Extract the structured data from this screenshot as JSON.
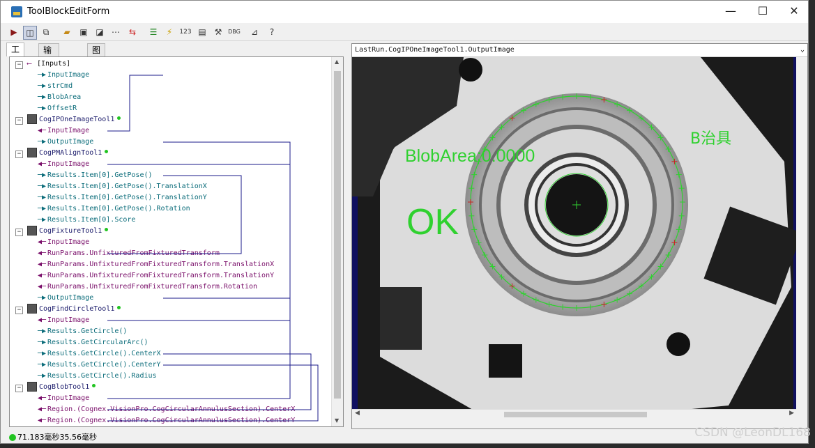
{
  "window": {
    "title": "ToolBlockEditForm"
  },
  "tabs": [
    {
      "label": "工具"
    },
    {
      "label": "输入/输出"
    },
    {
      "label": "图形"
    }
  ],
  "tree": [
    {
      "type": "head",
      "label": "[Inputs]"
    },
    {
      "type": "out",
      "label": "InputImage"
    },
    {
      "type": "out",
      "label": "strCmd"
    },
    {
      "type": "out",
      "label": "BlobArea"
    },
    {
      "type": "out",
      "label": "OffsetR"
    },
    {
      "type": "tool",
      "label": "CogIPOneImageTool1"
    },
    {
      "type": "in",
      "label": "InputImage"
    },
    {
      "type": "out",
      "label": "OutputImage"
    },
    {
      "type": "tool",
      "label": "CogPMAlignTool1"
    },
    {
      "type": "in",
      "label": "InputImage"
    },
    {
      "type": "out",
      "label": "Results.Item[0].GetPose()"
    },
    {
      "type": "out",
      "label": "Results.Item[0].GetPose().TranslationX"
    },
    {
      "type": "out",
      "label": "Results.Item[0].GetPose().TranslationY"
    },
    {
      "type": "out",
      "label": "Results.Item[0].GetPose().Rotation"
    },
    {
      "type": "out",
      "label": "Results.Item[0].Score"
    },
    {
      "type": "tool",
      "label": "CogFixtureTool1"
    },
    {
      "type": "in",
      "label": "InputImage"
    },
    {
      "type": "in",
      "label": "RunParams.UnfixturedFromFixturedTransform"
    },
    {
      "type": "in",
      "label": "RunParams.UnfixturedFromFixturedTransform.TranslationX"
    },
    {
      "type": "in",
      "label": "RunParams.UnfixturedFromFixturedTransform.TranslationY"
    },
    {
      "type": "in",
      "label": "RunParams.UnfixturedFromFixturedTransform.Rotation"
    },
    {
      "type": "out",
      "label": "OutputImage"
    },
    {
      "type": "tool",
      "label": "CogFindCircleTool1"
    },
    {
      "type": "in",
      "label": "InputImage"
    },
    {
      "type": "out",
      "label": "Results.GetCircle()"
    },
    {
      "type": "out",
      "label": "Results.GetCircularArc()"
    },
    {
      "type": "out",
      "label": "Results.GetCircle().CenterX"
    },
    {
      "type": "out",
      "label": "Results.GetCircle().CenterY"
    },
    {
      "type": "out",
      "label": "Results.GetCircle().Radius"
    },
    {
      "type": "tool",
      "label": "CogBlobTool1"
    },
    {
      "type": "in",
      "label": "InputImage"
    },
    {
      "type": "in",
      "label": "Region.(Cognex.VisionPro.CogCircularAnnulusSection).CenterX"
    },
    {
      "type": "in",
      "label": "Region.(Cognex.VisionPro.CogCircularAnnulusSection).CenterY"
    }
  ],
  "image_panel": {
    "selector": "LastRun.CogIPOneImageTool1.OutputImage",
    "overlay_blob_area": "BlobArea:0.0000",
    "overlay_result": "OK",
    "overlay_fixture": "B治具"
  },
  "status": {
    "text": "71.183毫秒35.56毫秒"
  },
  "watermark": "CSDN @LeonDL168",
  "colors": {
    "overlay_green": "#2fd12f",
    "overlay_red": "#cc2222"
  }
}
